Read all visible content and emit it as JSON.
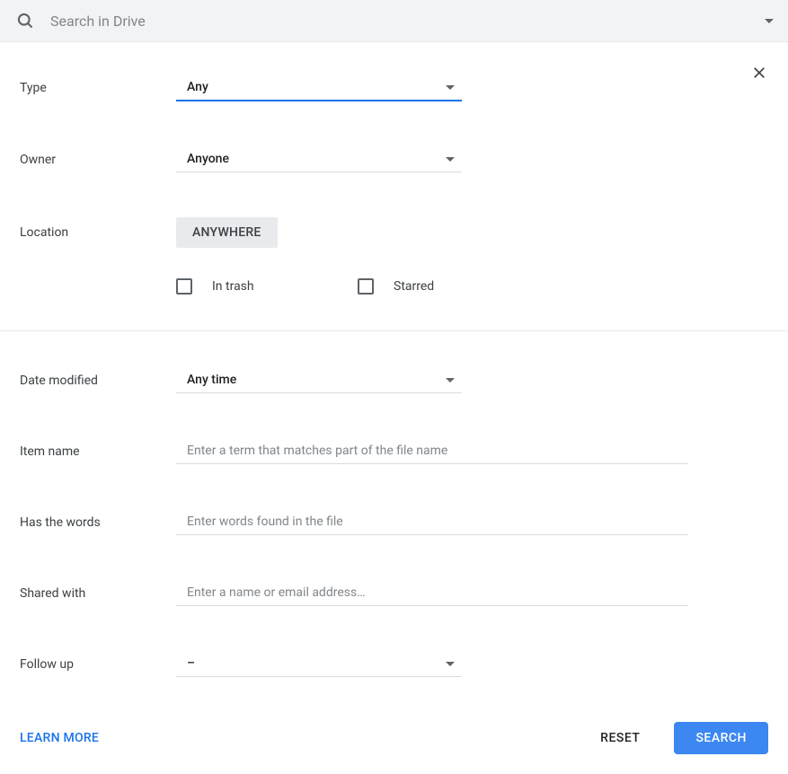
{
  "search": {
    "placeholder": "Search in Drive"
  },
  "filters": {
    "type_label": "Type",
    "type_value": "Any",
    "owner_label": "Owner",
    "owner_value": "Anyone",
    "location_label": "Location",
    "location_value": "ANYWHERE",
    "in_trash_label": "In trash",
    "starred_label": "Starred",
    "date_modified_label": "Date modified",
    "date_modified_value": "Any time",
    "item_name_label": "Item name",
    "item_name_placeholder": "Enter a term that matches part of the file name",
    "has_words_label": "Has the words",
    "has_words_placeholder": "Enter words found in the file",
    "shared_with_label": "Shared with",
    "shared_with_placeholder": "Enter a name or email address…",
    "follow_up_label": "Follow up",
    "follow_up_value": "–"
  },
  "footer": {
    "learn_more": "LEARN MORE",
    "reset": "RESET",
    "search": "SEARCH"
  }
}
